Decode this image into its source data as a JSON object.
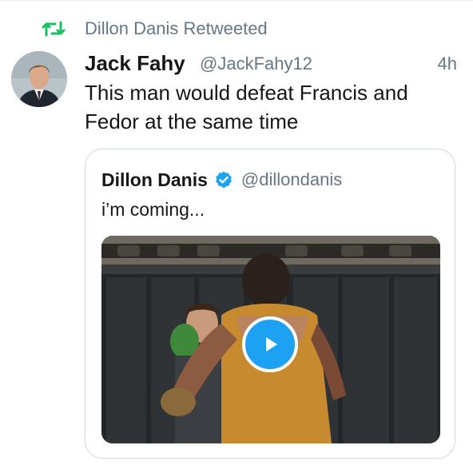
{
  "retweet": {
    "label": "Dillon Danis Retweeted",
    "icon": "retweet-icon",
    "color": "#17bf63"
  },
  "tweet": {
    "author_name": "Jack Fahy",
    "author_handle": "@JackFahy12",
    "time": "4h",
    "text": "This man would defeat Francis and Fedor at the same time",
    "avatar": "avatar-photo"
  },
  "quoted_tweet": {
    "author_name": "Dillon Danis",
    "verified": true,
    "author_handle": "@dillondanis",
    "text": "i’m coming...",
    "media": {
      "type": "video",
      "play_icon": "play-icon",
      "accent": "#1da1f2"
    }
  },
  "colors": {
    "text_primary": "#14171a",
    "text_secondary": "#657786",
    "border": "#ccd6dd",
    "verified_blue": "#1da1f2"
  }
}
